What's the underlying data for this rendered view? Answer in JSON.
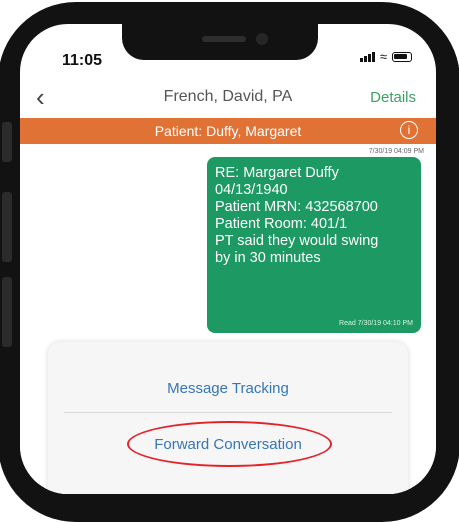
{
  "status_bar": {
    "time": "11:05"
  },
  "nav": {
    "back_icon": "chevron-left-icon",
    "title": "French, David, PA",
    "details_label": "Details"
  },
  "banner": {
    "text": "Patient: Duffy, Margaret",
    "info_icon_glyph": "i"
  },
  "message": {
    "sent_timestamp": "7/30/19 04:09 PM",
    "lines": [
      "RE: Margaret Duffy",
      "04/13/1940",
      "Patient MRN: 432568700",
      "Patient Room: 401/1",
      "PT said they would swing",
      "by in 30 minutes"
    ],
    "read_receipt": "Read 7/30/19 04:10 PM"
  },
  "action_sheet": {
    "items": [
      {
        "label": "Message Tracking"
      },
      {
        "label": "Forward Conversation"
      }
    ]
  },
  "colors": {
    "accent_green": "#1d9a63",
    "banner_orange": "#e07235",
    "link_blue": "#3676b8",
    "highlight_red": "#e3232b"
  }
}
